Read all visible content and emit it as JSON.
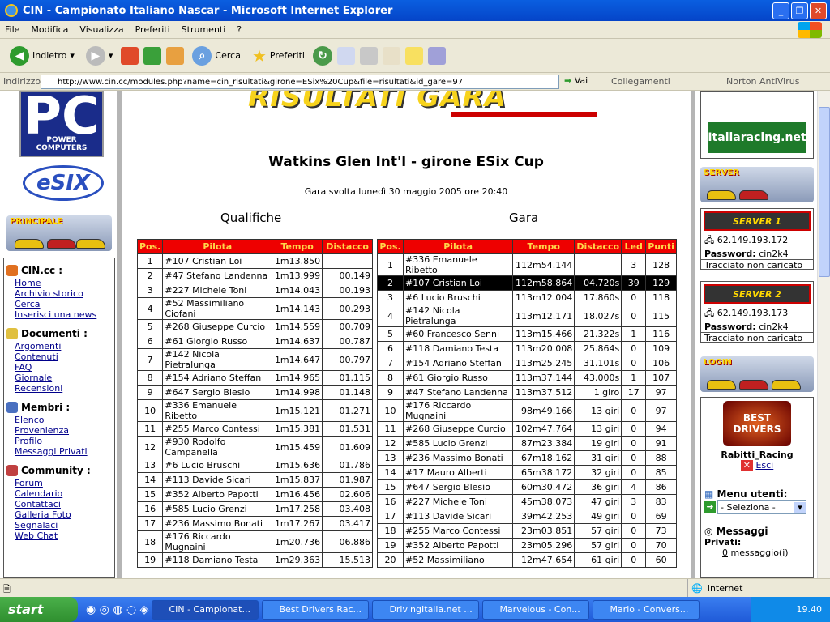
{
  "window": {
    "title": "CIN - Campionato Italiano Nascar - Microsoft Internet Explorer"
  },
  "menu": [
    "File",
    "Modifica",
    "Visualizza",
    "Preferiti",
    "Strumenti",
    "?"
  ],
  "toolbar": {
    "back": "Indietro",
    "search": "Cerca",
    "favorites": "Preferiti"
  },
  "address": {
    "label": "Indirizzo",
    "url": "http://www.cin.cc/modules.php?name=cin_risultati&girone=ESix%20Cup&file=risultati&id_gare=97",
    "go": "Vai",
    "links": "Collegamenti",
    "norton": "Norton AntiVirus"
  },
  "page": {
    "banner": "RISULTATI GARA",
    "title": "Watkins Glen Int'l - girone ESix Cup",
    "subtitle": "Gara svolta lunedì 30 maggio 2005 ore 20:40",
    "qual_title": "Qualifiche",
    "race_title": "Gara",
    "qual_headers": [
      "Pos.",
      "Pilota",
      "Tempo",
      "Distacco"
    ],
    "race_headers": [
      "Pos.",
      "Pilota",
      "Tempo",
      "Distacco",
      "Led",
      "Punti"
    ],
    "qual_rows": [
      [
        "1",
        "#107 Cristian Loi",
        "1m13.850",
        ""
      ],
      [
        "2",
        "#47 Stefano Landenna",
        "1m13.999",
        "00.149"
      ],
      [
        "3",
        "#227 Michele Toni",
        "1m14.043",
        "00.193"
      ],
      [
        "4",
        "#52 Massimiliano Ciofani",
        "1m14.143",
        "00.293"
      ],
      [
        "5",
        "#268 Giuseppe Curcio",
        "1m14.559",
        "00.709"
      ],
      [
        "6",
        "#61 Giorgio Russo",
        "1m14.637",
        "00.787"
      ],
      [
        "7",
        "#142 Nicola Pietralunga",
        "1m14.647",
        "00.797"
      ],
      [
        "8",
        "#154 Adriano Steffan",
        "1m14.965",
        "01.115"
      ],
      [
        "9",
        "#647 Sergio Blesio",
        "1m14.998",
        "01.148"
      ],
      [
        "10",
        "#336 Emanuele Ribetto",
        "1m15.121",
        "01.271"
      ],
      [
        "11",
        "#255 Marco Contessi",
        "1m15.381",
        "01.531"
      ],
      [
        "12",
        "#930 Rodolfo Campanella",
        "1m15.459",
        "01.609"
      ],
      [
        "13",
        "#6 Lucio Bruschi",
        "1m15.636",
        "01.786"
      ],
      [
        "14",
        "#113 Davide Sicari",
        "1m15.837",
        "01.987"
      ],
      [
        "15",
        "#352 Alberto Papotti",
        "1m16.456",
        "02.606"
      ],
      [
        "16",
        "#585 Lucio Grenzi",
        "1m17.258",
        "03.408"
      ],
      [
        "17",
        "#236 Massimo Bonati",
        "1m17.267",
        "03.417"
      ],
      [
        "18",
        "#176 Riccardo Mugnaini",
        "1m20.736",
        "06.886"
      ],
      [
        "19",
        "#118 Damiano Testa",
        "1m29.363",
        "15.513"
      ]
    ],
    "race_rows": [
      [
        "1",
        "#336 Emanuele Ribetto",
        "112m54.144",
        "",
        "3",
        "128"
      ],
      [
        "2",
        "#107 Cristian Loi",
        "112m58.864",
        "04.720s",
        "39",
        "129"
      ],
      [
        "3",
        "#6 Lucio Bruschi",
        "113m12.004",
        "17.860s",
        "0",
        "118"
      ],
      [
        "4",
        "#142 Nicola Pietralunga",
        "113m12.171",
        "18.027s",
        "0",
        "115"
      ],
      [
        "5",
        "#60 Francesco Senni",
        "113m15.466",
        "21.322s",
        "1",
        "116"
      ],
      [
        "6",
        "#118 Damiano Testa",
        "113m20.008",
        "25.864s",
        "0",
        "109"
      ],
      [
        "7",
        "#154 Adriano Steffan",
        "113m25.245",
        "31.101s",
        "0",
        "106"
      ],
      [
        "8",
        "#61 Giorgio Russo",
        "113m37.144",
        "43.000s",
        "1",
        "107"
      ],
      [
        "9",
        "#47 Stefano Landenna",
        "113m37.512",
        "1 giro",
        "17",
        "97"
      ],
      [
        "10",
        "#176 Riccardo Mugnaini",
        "98m49.166",
        "13 giri",
        "0",
        "97"
      ],
      [
        "11",
        "#268 Giuseppe Curcio",
        "102m47.764",
        "13 giri",
        "0",
        "94"
      ],
      [
        "12",
        "#585 Lucio Grenzi",
        "87m23.384",
        "19 giri",
        "0",
        "91"
      ],
      [
        "13",
        "#236 Massimo Bonati",
        "67m18.162",
        "31 giri",
        "0",
        "88"
      ],
      [
        "14",
        "#17 Mauro Alberti",
        "65m38.172",
        "32 giri",
        "0",
        "85"
      ],
      [
        "15",
        "#647 Sergio Blesio",
        "60m30.472",
        "36 giri",
        "4",
        "86"
      ],
      [
        "16",
        "#227 Michele Toni",
        "45m38.073",
        "47 giri",
        "3",
        "83"
      ],
      [
        "17",
        "#113 Davide Sicari",
        "39m42.253",
        "49 giri",
        "0",
        "69"
      ],
      [
        "18",
        "#255 Marco Contessi",
        "23m03.851",
        "57 giri",
        "0",
        "73"
      ],
      [
        "19",
        "#352 Alberto Papotti",
        "23m05.296",
        "57 giri",
        "0",
        "70"
      ],
      [
        "20",
        "#52 Massimiliano",
        "12m47.654",
        "61 giri",
        "0",
        "60"
      ]
    ]
  },
  "left": {
    "logo_pc": "PC",
    "logo_pc_sub": "POWER COMPUTERS",
    "esix": "eSIX",
    "principale": "PRINCIPALE",
    "cin_title": "CIN.cc :",
    "cin_links": [
      "Home",
      "Archivio storico",
      "Cerca",
      "Inserisci una news"
    ],
    "doc_title": "Documenti :",
    "doc_links": [
      "Argomenti",
      "Contenuti",
      "FAQ",
      "Giornale",
      "Recensioni"
    ],
    "mem_title": "Membri :",
    "mem_links": [
      "Elenco",
      "Provenienza",
      "Profilo",
      "Messaggi Privati"
    ],
    "com_title": "Community :",
    "com_links": [
      "Forum",
      "Calendario",
      "Contattaci",
      "Galleria Foto",
      "Segnalaci",
      "Web Chat"
    ]
  },
  "right": {
    "italiaracing": "Italiaracing.net",
    "server_label": "SERVER",
    "server1": {
      "name": "SERVER 1",
      "ip": "62.149.193.172",
      "pw_label": "Password:",
      "pw": "cin2k4",
      "track": "Tracciato non caricato"
    },
    "server2": {
      "name": "SERVER 2",
      "ip": "62.149.193.173",
      "pw_label": "Password:",
      "pw": "cin2k4",
      "track": "Tracciato non caricato"
    },
    "login_label": "LOGIN",
    "best": "BEST DRIVERS",
    "user": "Rabitti_Racing",
    "esci": "Esci",
    "menu_utenti": "Menu utenti:",
    "select": "- Seleziona -",
    "messaggi": "Messaggi",
    "privati": "Privati:",
    "msg_count": "0",
    "msg_text": "messaggio(i)"
  },
  "status": {
    "zone": "Internet"
  },
  "taskbar": {
    "start": "start",
    "tasks": [
      "CIN - Campionat...",
      "Best Drivers Rac...",
      "DrivingItalia.net ...",
      "Marvelous - Con...",
      "Mario - Convers..."
    ],
    "time": "19.40"
  }
}
